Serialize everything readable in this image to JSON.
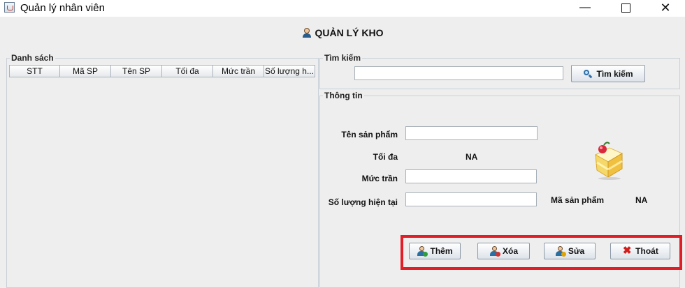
{
  "window": {
    "title": "Quản lý nhân viên",
    "minimize": "—",
    "close": "✕"
  },
  "header": {
    "icon": "person-icon",
    "title": "QUẢN LÝ KHO"
  },
  "list_panel": {
    "legend": "Danh sách",
    "columns": [
      "STT",
      "Mã SP",
      "Tên SP",
      "Tối đa",
      "Mức trần",
      "Số lượng h..."
    ]
  },
  "search_panel": {
    "legend": "Tìm kiếm",
    "input_value": "",
    "button_label": "Tìm kiếm",
    "button_icon": "search-icon"
  },
  "info_panel": {
    "legend": "Thông tin",
    "product_name_label": "Tên sản phẩm",
    "product_name_value": "",
    "max_label": "Tối đa",
    "max_value": "NA",
    "ceiling_label": "Mức trần",
    "ceiling_value": "",
    "current_qty_label": "Số lượng hiện tại",
    "current_qty_value": "",
    "product_code_label": "Mã sản phẩm",
    "product_code_value": "NA",
    "image_icon": "cake-icon"
  },
  "actions": {
    "add_label": "Thêm",
    "delete_label": "Xóa",
    "edit_label": "Sửa",
    "exit_label": "Thoát",
    "highlight_color": "#e11d25"
  }
}
